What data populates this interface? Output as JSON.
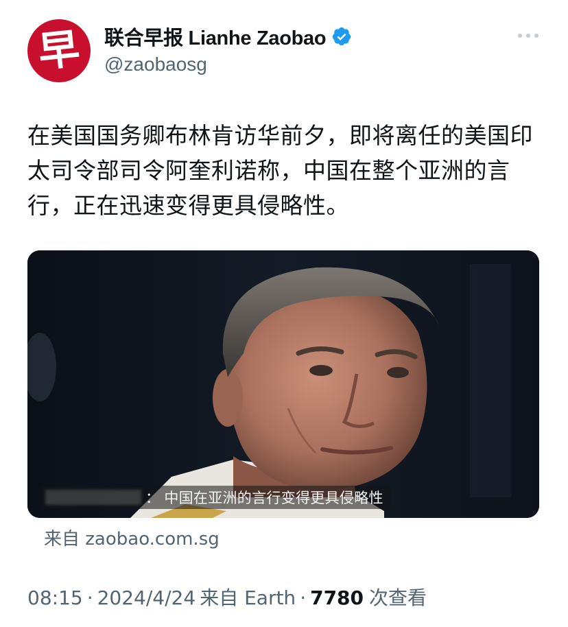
{
  "account": {
    "avatar_glyph": "早",
    "display_name": "联合早报 Lianhe Zaobao",
    "handle": "@zaobaosg",
    "verified": true,
    "avatar_color": "#c8102e",
    "verified_color": "#1d9bf0"
  },
  "tweet": {
    "text": "在美国国务卿布林肯访华前夕，即将离任的美国印太司令部司令阿奎利诺称，中国在整个亚洲的言行，正在迅速变得更具侵略性。"
  },
  "media": {
    "caption_separator": "：",
    "caption": "中国在亚洲的言行变得更具侵略性"
  },
  "card": {
    "source": "来自 zaobao.com.sg"
  },
  "meta": {
    "time": "08:15",
    "date": "2024/4/24",
    "client": "来自 Earth",
    "separator": "·",
    "view_count": "7780",
    "views_label": "次查看"
  },
  "icons": {
    "more": "more-horizontal-icon",
    "verified": "verified-badge-icon"
  }
}
